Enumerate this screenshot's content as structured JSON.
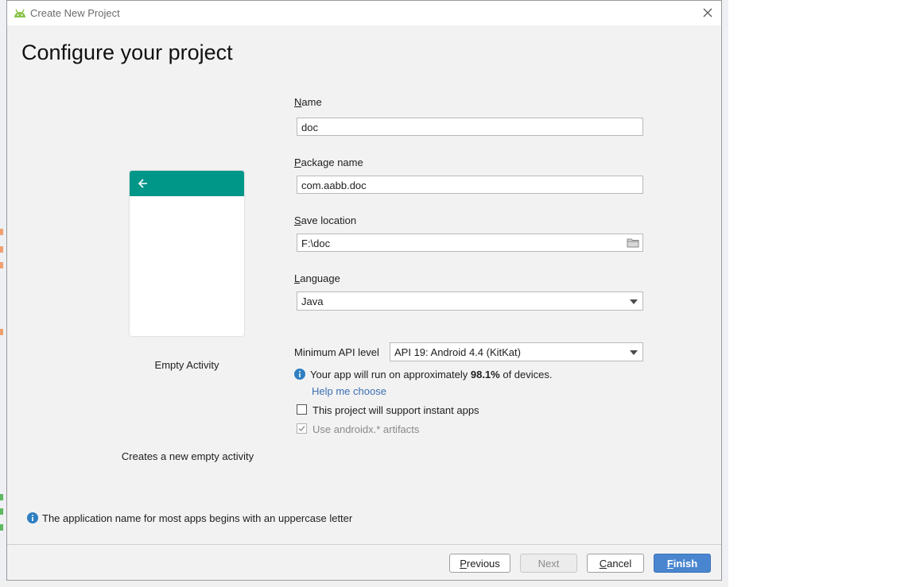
{
  "window": {
    "title": "Create New Project"
  },
  "page": {
    "heading": "Configure your project"
  },
  "template": {
    "name": "Empty Activity",
    "description": "Creates a new empty activity"
  },
  "form": {
    "name": {
      "mnemonic": "N",
      "label_rest": "ame",
      "value": "doc"
    },
    "package": {
      "mnemonic": "P",
      "label_rest": "ackage name",
      "value": "com.aabb.doc"
    },
    "location": {
      "mnemonic": "S",
      "label_rest": "ave location",
      "value": "F:\\doc"
    },
    "language": {
      "mnemonic": "L",
      "label_rest": "anguage",
      "value": "Java"
    },
    "min_api": {
      "label": "Minimum API level",
      "value": "API 19: Android 4.4 (KitKat)"
    }
  },
  "devices": {
    "prefix": "Your app will run on approximately ",
    "percent": "98.1%",
    "suffix": " of devices."
  },
  "help_link": "Help me choose",
  "checkboxes": {
    "instant": {
      "label": "This project will support instant apps",
      "checked": false
    },
    "androidx": {
      "label": "Use androidx.* artifacts",
      "checked": true,
      "disabled": true
    }
  },
  "hint": "The application name for most apps begins with an uppercase letter",
  "buttons": {
    "previous": {
      "mnemonic": "P",
      "label_rest": "revious"
    },
    "next": {
      "label": "Next"
    },
    "cancel": {
      "mnemonic": "C",
      "label_rest": "ancel"
    },
    "finish": {
      "mnemonic": "F",
      "label_rest": "inish"
    }
  },
  "colors": {
    "accent": "#009688",
    "primary_button": "#4a86cf",
    "link": "#3d6fb4",
    "info_icon": "#2f7fc1"
  },
  "icons": [
    "android-icon",
    "close-icon",
    "back-arrow-icon",
    "folder-icon",
    "dropdown-caret-icon",
    "info-icon",
    "checkbox-icon"
  ]
}
